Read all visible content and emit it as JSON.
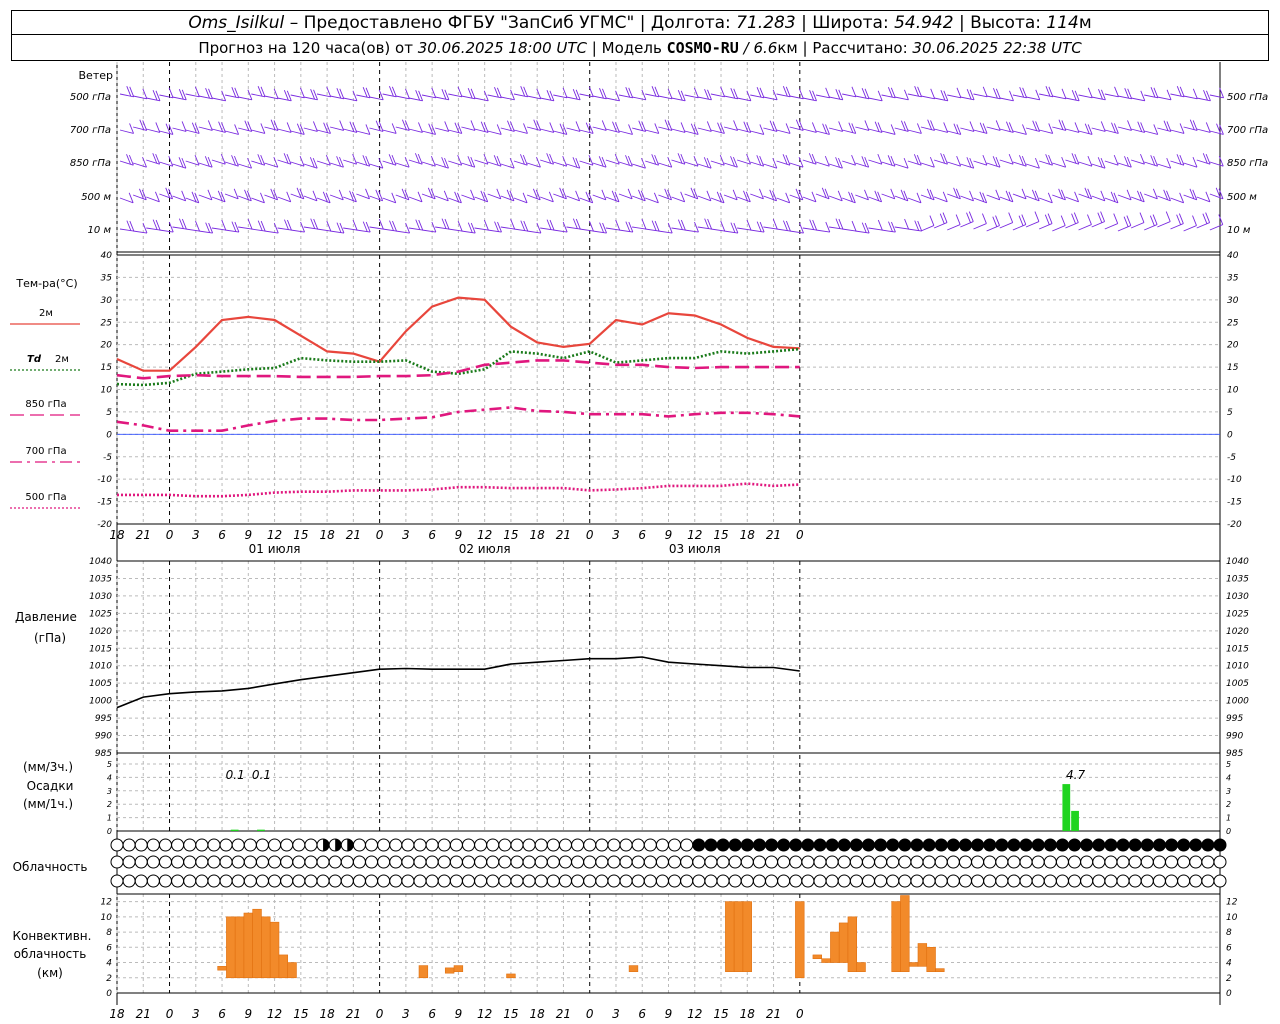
{
  "header": {
    "station": "Oms_Isilkul",
    "dash": "–",
    "provider": "Предоставлено ФГБУ \"ЗапСиб УГМС\"",
    "lon_label": "Долгота:",
    "lon": "71.283",
    "lat_label": "Широта:",
    "lat": "54.942",
    "alt_label": "Высота:",
    "alt": "114",
    "alt_unit": "м",
    "sep": "|",
    "fc_prefix": "Прогноз на 120 часа(ов) от",
    "fc_time": "30.06.2025 18:00 UTC",
    "model_label": "Модель",
    "model": "COSMO-RU",
    "slash": "/",
    "res": "6.6",
    "res_unit": "км",
    "calc_label": "Рассчитано:",
    "calc_time": "30.06.2025 22:38 UTC"
  },
  "time_axis": {
    "ticks": [
      "18",
      "21",
      "0",
      "3",
      "6",
      "9",
      "12",
      "15",
      "18",
      "21",
      "0",
      "3",
      "6",
      "9",
      "12",
      "15",
      "18",
      "21",
      "0",
      "3",
      "6",
      "9",
      "12",
      "15",
      "18",
      "21",
      "0"
    ],
    "dates": [
      {
        "label": "01 июля",
        "tick_index": 6
      },
      {
        "label": "02 июля",
        "tick_index": 14
      },
      {
        "label": "03 июля",
        "tick_index": 22
      }
    ]
  },
  "wind_panel": {
    "title": "Ветер",
    "levels": [
      "500 гПа",
      "700 гПа",
      "850 гПа",
      "500 м",
      "10 м"
    ],
    "right_levels": [
      "500 гПа",
      "700 гПа",
      "850 гПа",
      "500 м",
      "10 м"
    ],
    "color": "#7a2be0"
  },
  "chart_data": [
    {
      "type": "line",
      "title": "Тем-ра(°C)",
      "ylim": [
        -20,
        40
      ],
      "yticks": [
        "40",
        "35",
        "30",
        "25",
        "20",
        "15",
        "10",
        "5",
        "0",
        "-5",
        "-10",
        "-15",
        "-20"
      ],
      "grid": true,
      "series": [
        {
          "name": "2м",
          "color": "#e8463c",
          "style": "solid",
          "values": [
            16.8,
            14.2,
            14.2,
            19.5,
            25.5,
            26.2,
            25.5,
            22,
            18.5,
            18,
            16.2,
            23,
            28.5,
            30.5,
            30,
            24,
            20.5,
            19.5,
            20.2,
            25.5,
            24.5,
            27,
            26.5,
            24.5,
            21.5,
            19.5,
            19.2
          ]
        },
        {
          "name": "Td 2м",
          "color": "#1a7a1a",
          "style": "dotted",
          "values": [
            11.2,
            11,
            11.5,
            13.5,
            14,
            14.5,
            14.8,
            17,
            16.5,
            16.2,
            16.2,
            16.5,
            14,
            13.5,
            14.5,
            18.5,
            18,
            17,
            18.5,
            16,
            16.5,
            17,
            17,
            18.5,
            18,
            18.5,
            19
          ]
        },
        {
          "name": "850 гПа",
          "color": "#e0177e",
          "style": "longdash",
          "values": [
            13.2,
            12.5,
            13,
            13.2,
            13,
            13,
            13,
            12.8,
            12.8,
            12.8,
            13,
            13,
            13.2,
            14,
            15.5,
            16,
            16.5,
            16.5,
            16,
            15.5,
            15.5,
            15,
            14.8,
            15,
            15,
            15,
            15
          ]
        },
        {
          "name": "700 гПа",
          "color": "#e0177e",
          "style": "dashdot",
          "values": [
            2.8,
            2,
            0.8,
            0.8,
            0.8,
            2,
            3,
            3.5,
            3.5,
            3.2,
            3.2,
            3.5,
            3.8,
            5,
            5.5,
            6,
            5.2,
            5,
            4.5,
            4.5,
            4.5,
            4,
            4.5,
            4.8,
            4.8,
            4.5,
            4
          ]
        },
        {
          "name": "500 гПа",
          "color": "#e0177e",
          "style": "dotted",
          "values": [
            -13.5,
            -13.5,
            -13.5,
            -13.8,
            -13.8,
            -13.5,
            -13,
            -12.8,
            -12.8,
            -12.5,
            -12.5,
            -12.5,
            -12.3,
            -11.8,
            -11.8,
            -12,
            -12,
            -12,
            -12.5,
            -12.3,
            -12,
            -11.5,
            -11.5,
            -11.5,
            -11,
            -11.5,
            -11.2
          ]
        }
      ]
    },
    {
      "type": "line",
      "ylabel": "Давление",
      "unit": "(гПа)",
      "ylim": [
        985,
        1040
      ],
      "yticks": [
        "1040",
        "1035",
        "1030",
        "1025",
        "1020",
        "1015",
        "1010",
        "1005",
        "1000",
        "995",
        "990",
        "985"
      ],
      "grid": true,
      "series": [
        {
          "color": "#000000",
          "values": [
            998,
            1001,
            1002,
            1002.5,
            1002.8,
            1003.5,
            1004.8,
            1006,
            1007,
            1008,
            1009,
            1009.2,
            1009,
            1009,
            1009,
            1010.5,
            1011,
            1011.5,
            1012,
            1012,
            1012.5,
            1011,
            1010.5,
            1010,
            1009.5,
            1009.5,
            1008.5
          ]
        }
      ]
    },
    {
      "type": "bar",
      "ylabel": "Осадки",
      "units": [
        "(мм/3ч.)",
        "(мм/1ч.)"
      ],
      "ylim": [
        0,
        5
      ],
      "yticks": [
        "5",
        "4",
        "3",
        "2",
        "1",
        "0"
      ],
      "labels": [
        {
          "text": "0.1",
          "x_hour": 13.5
        },
        {
          "text": "0.1",
          "x_hour": 16.5
        },
        {
          "text": "4.7",
          "x_hour": 109.5
        }
      ],
      "bars": [
        {
          "x_hour": 13.5,
          "value": 0.1
        },
        {
          "x_hour": 16.5,
          "value": 0.1
        },
        {
          "x_hour": 108.5,
          "value": 3.5
        },
        {
          "x_hour": 109.5,
          "value": 1.5
        }
      ],
      "color": "#1fd41f"
    },
    {
      "type": "table",
      "title": "Облачность",
      "rows": [
        "00000000000000000111000000000000000000000000000022222222222222222222222222222222222222222222",
        "00000000000000000000000000000000000000000000000000000000000000000000000000000000000000000000",
        "00000000000000000000000000000000000000000000000000000000000000000000000000000000000000000000"
      ],
      "legend": "0 = clear, 1 = partly covered, 2 = overcast"
    },
    {
      "type": "bar",
      "ylabel": "Конвективн. облачность",
      "unit": "(км)",
      "ylim": [
        0,
        13
      ],
      "yticks": [
        "12",
        "10",
        "8",
        "6",
        "4",
        "2",
        "0"
      ],
      "color": "#f28a2a",
      "bars": [
        {
          "x_hour": 12,
          "bottom": 3,
          "top": 3.5
        },
        {
          "x_hour": 13,
          "bottom": 2,
          "top": 10
        },
        {
          "x_hour": 14,
          "bottom": 2,
          "top": 10
        },
        {
          "x_hour": 15,
          "bottom": 2,
          "top": 10.5
        },
        {
          "x_hour": 16,
          "bottom": 2,
          "top": 11
        },
        {
          "x_hour": 17,
          "bottom": 2,
          "top": 10
        },
        {
          "x_hour": 18,
          "bottom": 2,
          "top": 9.3
        },
        {
          "x_hour": 19,
          "bottom": 2,
          "top": 5
        },
        {
          "x_hour": 20,
          "bottom": 2,
          "top": 4
        },
        {
          "x_hour": 35,
          "bottom": 2,
          "top": 3.6
        },
        {
          "x_hour": 38,
          "bottom": 2.6,
          "top": 3.3
        },
        {
          "x_hour": 39,
          "bottom": 2.8,
          "top": 3.6
        },
        {
          "x_hour": 45,
          "bottom": 2,
          "top": 2.5
        },
        {
          "x_hour": 59,
          "bottom": 2.8,
          "top": 3.6
        },
        {
          "x_hour": 70,
          "bottom": 2.8,
          "top": 12
        },
        {
          "x_hour": 71,
          "bottom": 2.8,
          "top": 12
        },
        {
          "x_hour": 72,
          "bottom": 2.8,
          "top": 12
        },
        {
          "x_hour": 78,
          "bottom": 2,
          "top": 12
        },
        {
          "x_hour": 80,
          "bottom": 4.5,
          "top": 5
        },
        {
          "x_hour": 81,
          "bottom": 4,
          "top": 4.5
        },
        {
          "x_hour": 82,
          "bottom": 4,
          "top": 8
        },
        {
          "x_hour": 83,
          "bottom": 4,
          "top": 9.2
        },
        {
          "x_hour": 84,
          "bottom": 2.8,
          "top": 10
        },
        {
          "x_hour": 85,
          "bottom": 2.8,
          "top": 4
        },
        {
          "x_hour": 89,
          "bottom": 2.8,
          "top": 12
        },
        {
          "x_hour": 90,
          "bottom": 2.8,
          "top": 12.8
        },
        {
          "x_hour": 91,
          "bottom": 3.5,
          "top": 4
        },
        {
          "x_hour": 92,
          "bottom": 3.5,
          "top": 6.5
        },
        {
          "x_hour": 93,
          "bottom": 2.8,
          "top": 6
        },
        {
          "x_hour": 94,
          "bottom": 2.8,
          "top": 3.2
        }
      ]
    }
  ],
  "temp_legend": {
    "t2m": "2м",
    "td_prefix": "Td",
    "td_suffix": "2м",
    "l850": "850 гПа",
    "l700": "700 гПа",
    "l500": "500 гПа"
  }
}
